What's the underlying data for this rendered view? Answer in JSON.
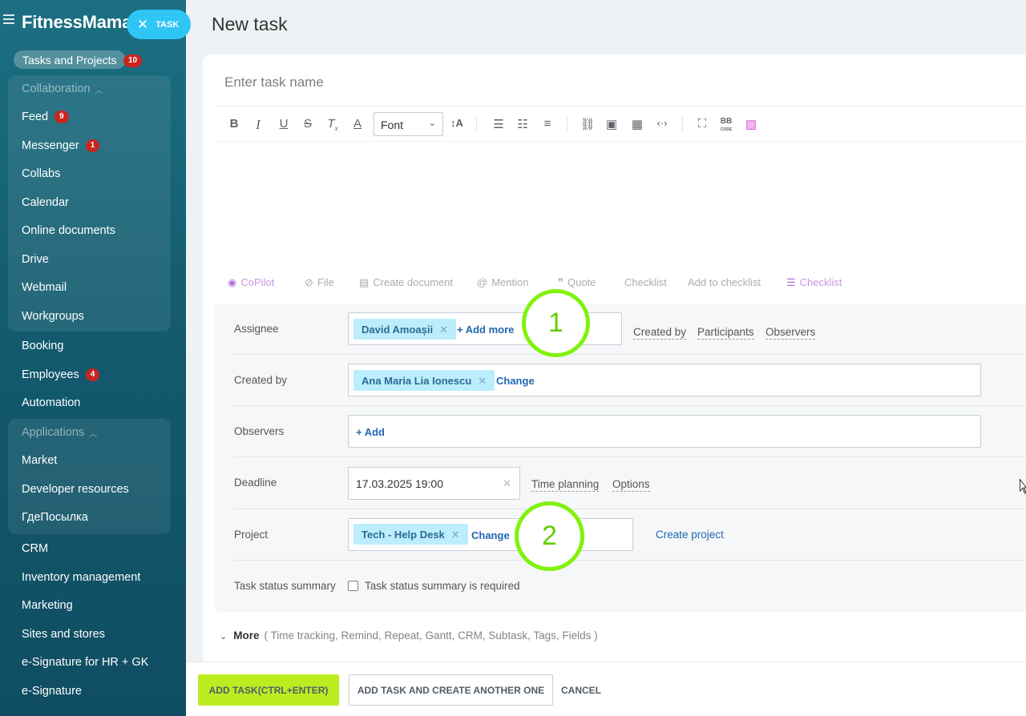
{
  "sidebar": {
    "brand": "FitnessMama",
    "task_pill_label": "TASK",
    "tasks_projects": {
      "label": "Tasks and Projects",
      "badge": "10"
    },
    "collaboration_header": "Collaboration",
    "collab_items": [
      {
        "label": "Feed",
        "badge": "9"
      },
      {
        "label": "Messenger",
        "badge": "1"
      },
      {
        "label": "Collabs"
      },
      {
        "label": "Calendar"
      },
      {
        "label": "Online documents"
      },
      {
        "label": "Drive"
      },
      {
        "label": "Webmail"
      },
      {
        "label": "Workgroups"
      }
    ],
    "mid_items": [
      {
        "label": "Booking"
      },
      {
        "label": "Employees",
        "badge": "4"
      },
      {
        "label": "Automation"
      }
    ],
    "applications_header": "Applications",
    "app_items": [
      {
        "label": "Market"
      },
      {
        "label": "Developer resources"
      },
      {
        "label": "ГдеПосылка"
      }
    ],
    "bottom_items": [
      {
        "label": "CRM"
      },
      {
        "label": "Inventory management"
      },
      {
        "label": "Marketing"
      },
      {
        "label": "Sites and stores"
      },
      {
        "label": "e-Signature for HR + GK"
      },
      {
        "label": "e-Signature"
      }
    ]
  },
  "page": {
    "title": "New task",
    "task_name_placeholder": "Enter task name"
  },
  "editor": {
    "font_select": "Font",
    "toolbar_icons": [
      "bold-icon",
      "italic-icon",
      "underline-icon",
      "strikethrough-icon",
      "clear-format-icon",
      "text-color-icon",
      "font-size-icon",
      "numbered-list-icon",
      "bulleted-list-icon",
      "align-icon",
      "link-icon",
      "image-icon",
      "table-icon",
      "code-icon",
      "fullscreen-icon",
      "bbcode-icon",
      "ai-image-icon"
    ],
    "bb_label": "BB",
    "bb_sub": "CODE"
  },
  "attach_bar": {
    "copilot": "CoPilot",
    "file": "File",
    "create_document": "Create document",
    "mention": "Mention",
    "quote": "Quote",
    "checklist": "Checklist",
    "add_to_checklist": "Add to checklist",
    "checklist_alt": "Checklist"
  },
  "form": {
    "assignee": {
      "label": "Assignee",
      "chip": "David Amoașii",
      "add_more": "+ Add more",
      "links": [
        "Created by",
        "Participants",
        "Observers"
      ]
    },
    "created_by": {
      "label": "Created by",
      "chip": "Ana Maria Lia Ionescu",
      "change": "Change"
    },
    "observers": {
      "label": "Observers",
      "add": "+ Add"
    },
    "deadline": {
      "label": "Deadline",
      "value": "17.03.2025 19:00",
      "links": [
        "Time planning",
        "Options"
      ]
    },
    "project": {
      "label": "Project",
      "chip": "Tech - Help Desk",
      "change": "Change",
      "create": "Create project"
    },
    "status_summary": {
      "label": "Task status summary",
      "checkbox_label": "Task status summary is required",
      "checked": false
    }
  },
  "annotations": [
    "1",
    "2"
  ],
  "more": {
    "label": "More",
    "items": "( Time tracking,  Remind,  Repeat,  Gantt,  CRM,  Subtask,  Tags,  Fields )"
  },
  "footer": {
    "add_task": "ADD TASK(CTRL+ENTER)",
    "add_another": "ADD TASK AND CREATE ANOTHER ONE",
    "cancel": "CANCEL"
  },
  "colors": {
    "sidebar_top": "#1c6f82",
    "task_pill": "#2fc6f6",
    "chip_bg": "#bcedfc",
    "add_button": "#bbed21",
    "annotation_ring": "#80f20b",
    "badge": "#c8261f"
  }
}
